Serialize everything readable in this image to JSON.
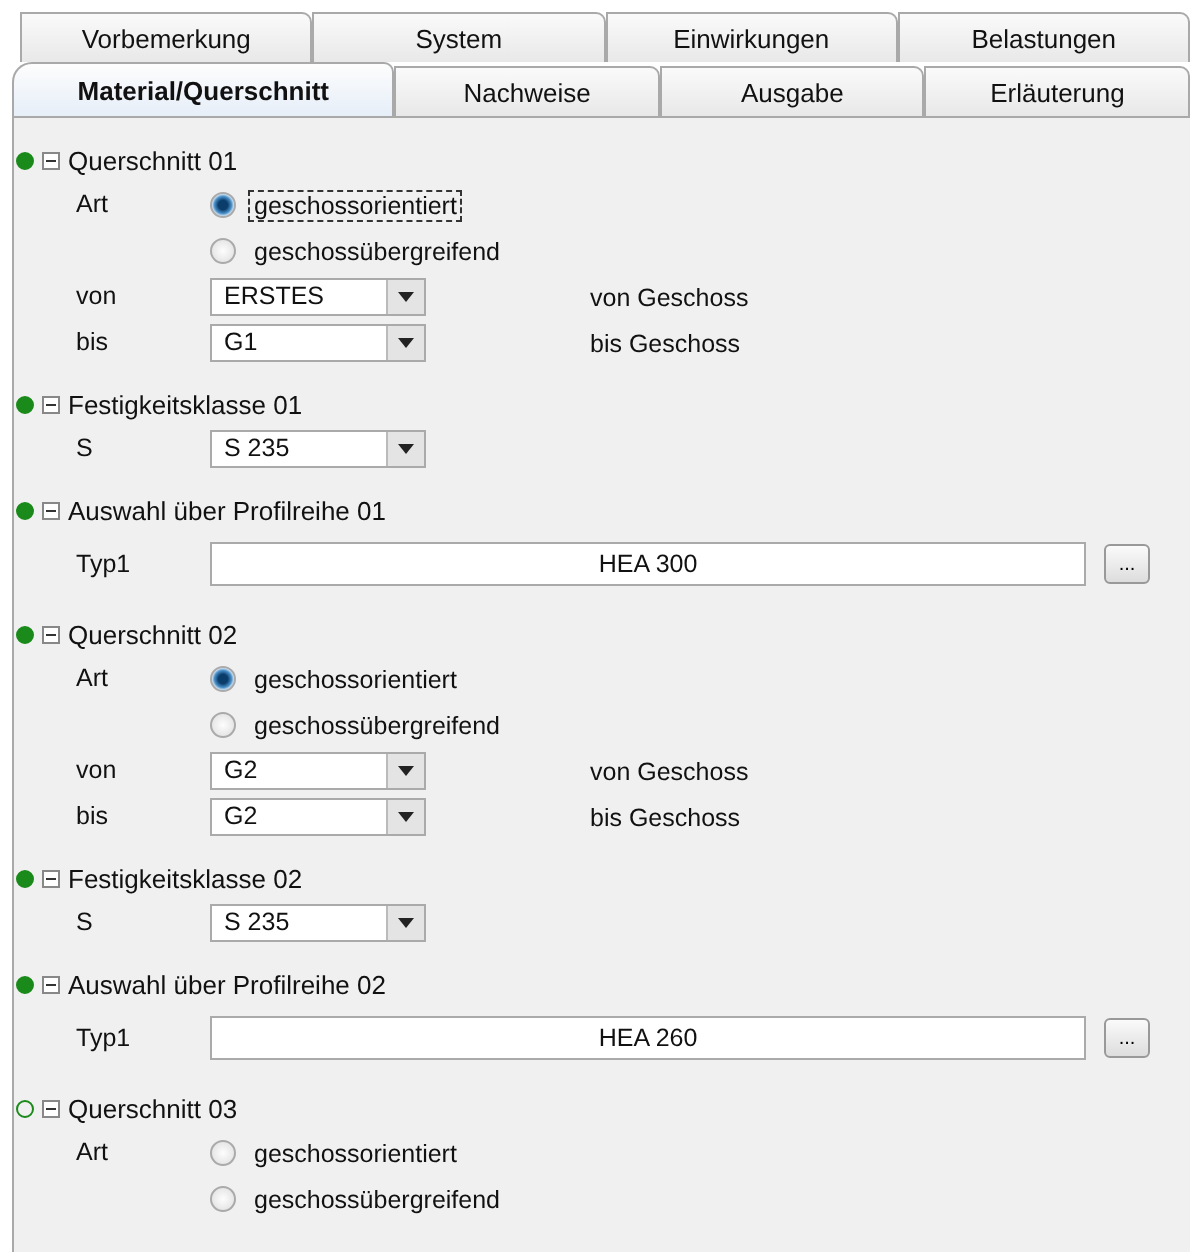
{
  "tab_rows": [
    {
      "tabs": [
        {
          "label": "Vorbemerkung",
          "selected": false
        },
        {
          "label": "System",
          "selected": false
        },
        {
          "label": "Einwirkungen",
          "selected": false
        },
        {
          "label": "Belastungen",
          "selected": false
        }
      ]
    },
    {
      "tabs": [
        {
          "label": "Material/Querschnitt",
          "selected": true
        },
        {
          "label": "Nachweise",
          "selected": false
        },
        {
          "label": "Ausgabe",
          "selected": false
        },
        {
          "label": "Erläuterung",
          "selected": false
        }
      ]
    }
  ],
  "sections": [
    {
      "title": "Querschnitt 01",
      "complete": true,
      "expanded": true,
      "rows": [
        {
          "kind": "radio",
          "label": "Art",
          "options": [
            {
              "label": "geschossorientiert",
              "selected": true,
              "focused": true
            },
            {
              "label": "geschossübergreifend",
              "selected": false,
              "focused": false
            }
          ]
        },
        {
          "kind": "combo",
          "label": "von",
          "value": "ERSTES",
          "note": "von Geschoss"
        },
        {
          "kind": "combo",
          "label": "bis",
          "value": "G1",
          "note": "bis Geschoss"
        }
      ]
    },
    {
      "title": "Festigkeitsklasse 01",
      "complete": true,
      "expanded": true,
      "rows": [
        {
          "kind": "combo",
          "label": "S",
          "value": "S 235"
        }
      ]
    },
    {
      "title": "Auswahl über Profilreihe 01",
      "complete": true,
      "expanded": true,
      "rows": [
        {
          "kind": "field",
          "label": "Typ1",
          "value": "HEA 300",
          "button": "..."
        }
      ]
    },
    {
      "title": "Querschnitt 02",
      "complete": true,
      "expanded": true,
      "rows": [
        {
          "kind": "radio",
          "label": "Art",
          "options": [
            {
              "label": "geschossorientiert",
              "selected": true,
              "focused": false
            },
            {
              "label": "geschossübergreifend",
              "selected": false,
              "focused": false
            }
          ]
        },
        {
          "kind": "combo",
          "label": "von",
          "value": "G2",
          "note": "von Geschoss"
        },
        {
          "kind": "combo",
          "label": "bis",
          "value": "G2",
          "note": "bis Geschoss"
        }
      ]
    },
    {
      "title": "Festigkeitsklasse 02",
      "complete": true,
      "expanded": true,
      "rows": [
        {
          "kind": "combo",
          "label": "S",
          "value": "S 235"
        }
      ]
    },
    {
      "title": "Auswahl über Profilreihe 02",
      "complete": true,
      "expanded": true,
      "rows": [
        {
          "kind": "field",
          "label": "Typ1",
          "value": "HEA 260",
          "button": "..."
        }
      ]
    },
    {
      "title": "Querschnitt 03",
      "complete": false,
      "expanded": true,
      "rows": [
        {
          "kind": "radio",
          "label": "Art",
          "options": [
            {
              "label": "geschossorientiert",
              "selected": false,
              "focused": false
            },
            {
              "label": "geschossübergreifend",
              "selected": false,
              "focused": false
            }
          ]
        }
      ]
    }
  ]
}
